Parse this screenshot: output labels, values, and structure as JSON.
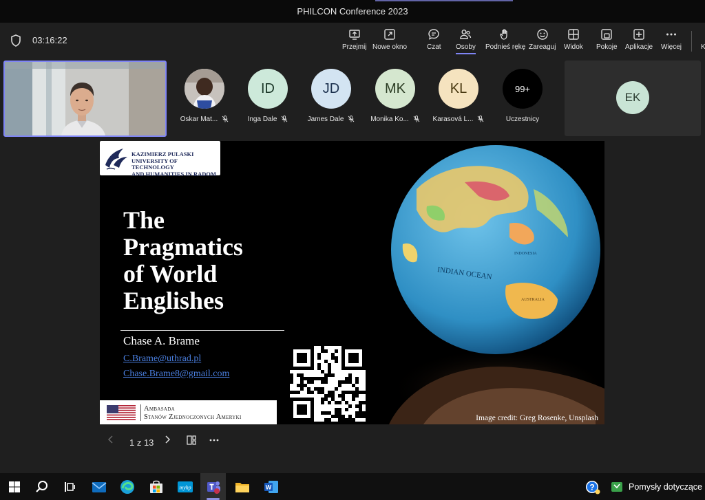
{
  "window": {
    "title": "PHILCON Conference 2023"
  },
  "meeting": {
    "timer": "03:16:22"
  },
  "toolbar": {
    "buttons": [
      {
        "label": "Przejmij",
        "icon": "share-screen-icon"
      },
      {
        "label": "Nowe okno",
        "icon": "new-window-icon"
      },
      {
        "label": "Czat",
        "icon": "chat-icon"
      },
      {
        "label": "Osoby",
        "icon": "people-icon"
      },
      {
        "label": "Podnieś rękę",
        "icon": "raise-hand-icon"
      },
      {
        "label": "Zareaguj",
        "icon": "react-icon"
      },
      {
        "label": "Widok",
        "icon": "grid-view-icon"
      },
      {
        "label": "Pokoje",
        "icon": "rooms-icon"
      },
      {
        "label": "Aplikacje",
        "icon": "add-apps-icon"
      },
      {
        "label": "Więcej",
        "icon": "more-icon"
      }
    ],
    "active": "Osoby",
    "accent_color": "#7f85f5",
    "overflow_text": "K"
  },
  "participants": [
    {
      "name": "Oskar Mat...",
      "initials": "",
      "photo": true,
      "bg": "#d9d9d9",
      "fg": "#333333"
    },
    {
      "name": "Inga Dale",
      "initials": "ID",
      "bg": "#cde9da",
      "fg": "#1e3a2b"
    },
    {
      "name": "James Dale",
      "initials": "JD",
      "bg": "#d3e4f2",
      "fg": "#1e3350"
    },
    {
      "name": "Monika Ko...",
      "initials": "MK",
      "bg": "#d5e7cf",
      "fg": "#2c3d24"
    },
    {
      "name": "Karasová L...",
      "initials": "KL",
      "bg": "#f5e3bf",
      "fg": "#4a3a12"
    },
    {
      "name": "Uczestnicy",
      "initials": "99+",
      "bg": "#000000",
      "fg": "#ffffff",
      "overflow": true
    }
  ],
  "pinned_tile": {
    "initials": "EK"
  },
  "slide": {
    "logo_lines": [
      "KAZIMIERZ PULASKI",
      "UNIVERSITY OF TECHNOLOGY",
      "AND HUMANITIES IN RADOM"
    ],
    "title_lines": [
      "The",
      "Pragmatics",
      "of World",
      "Englishes"
    ],
    "presenter": "Chase A. Brame",
    "emails": [
      "C.Brame@uthrad.pl",
      "Chase.Brame8@gmail.com"
    ],
    "globe_label": "INDIAN OCEAN",
    "globe_label_2": "AUSTRALIA",
    "globe_label_3": "INDONESIA",
    "embassy_lines": [
      "Ambasada",
      "Stanów Zjednoczonych Ameryki"
    ],
    "credit": "Image credit: Greg Rosenke, Unsplash"
  },
  "slide_nav": {
    "position": "1 z 13"
  },
  "taskbar": {
    "items": [
      "start-icon",
      "search-icon",
      "task-view-icon",
      "mail-icon",
      "edge-icon",
      "store-icon",
      "hp-icon",
      "teams-icon",
      "file-explorer-icon",
      "word-icon"
    ],
    "news_text": "Pomysły dotyczące li"
  }
}
